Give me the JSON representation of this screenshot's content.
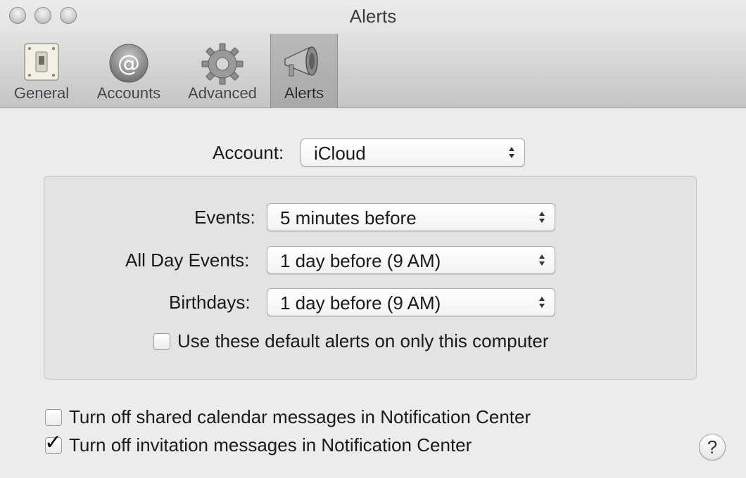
{
  "window": {
    "title": "Alerts"
  },
  "toolbar": {
    "tabs": [
      {
        "label": "General",
        "icon": "light-switch-icon"
      },
      {
        "label": "Accounts",
        "icon": "at-sign-icon"
      },
      {
        "label": "Advanced",
        "icon": "gear-icon"
      },
      {
        "label": "Alerts",
        "icon": "megaphone-icon",
        "selected": true
      }
    ]
  },
  "account": {
    "label": "Account:",
    "value": "iCloud"
  },
  "defaults": {
    "events": {
      "label": "Events:",
      "value": "5 minutes before"
    },
    "all_day_events": {
      "label": "All Day Events:",
      "value": "1 day before (9 AM)"
    },
    "birthdays": {
      "label": "Birthdays:",
      "value": "1 day before (9 AM)"
    },
    "local_only": {
      "label": "Use these default alerts on only this computer",
      "checked": false
    }
  },
  "options": {
    "shared_calendar": {
      "label": "Turn off shared calendar messages in Notification Center",
      "checked": false
    },
    "invitations": {
      "label": "Turn off invitation messages in Notification Center",
      "checked": true
    }
  },
  "help": {
    "symbol": "?"
  }
}
